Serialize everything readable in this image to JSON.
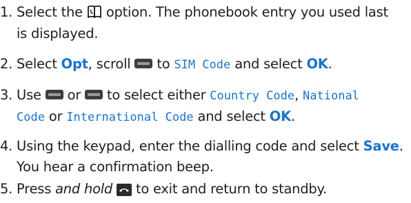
{
  "steps": [
    {
      "number": "1.",
      "a": " Select the ",
      "icon": "phonebook-icon",
      "b": " option. The phonebook entry you used last",
      "line2": "is displayed."
    },
    {
      "number": "2.",
      "a": " Select ",
      "key1": "Opt",
      "b": ", scroll ",
      "icon": "scroll-key-icon",
      "c": " to ",
      "lcd1": "SIM Code",
      "d": " and select ",
      "key2": "OK",
      "e": "."
    },
    {
      "number": "3.",
      "a": " Use ",
      "icon1": "scroll-up-key-icon",
      "b": " or ",
      "icon2": "scroll-down-key-icon",
      "c": " to select either ",
      "lcd1": "Country Code",
      "d": ", ",
      "lcd2": "National",
      "lcd3": "Code",
      "e": " or ",
      "lcd4": "International Code",
      "f": " and select ",
      "key1": "OK",
      "g": "."
    },
    {
      "number": "4.",
      "a": " Using the keypad, enter the dialling code and select ",
      "key1": "Save",
      "b": ".",
      "line2": "You hear a confirmation beep."
    },
    {
      "number": "5.",
      "a": " Press ",
      "em": "and hold",
      "icon": "end-call-key-icon",
      "b": " to exit and return to standby."
    }
  ]
}
